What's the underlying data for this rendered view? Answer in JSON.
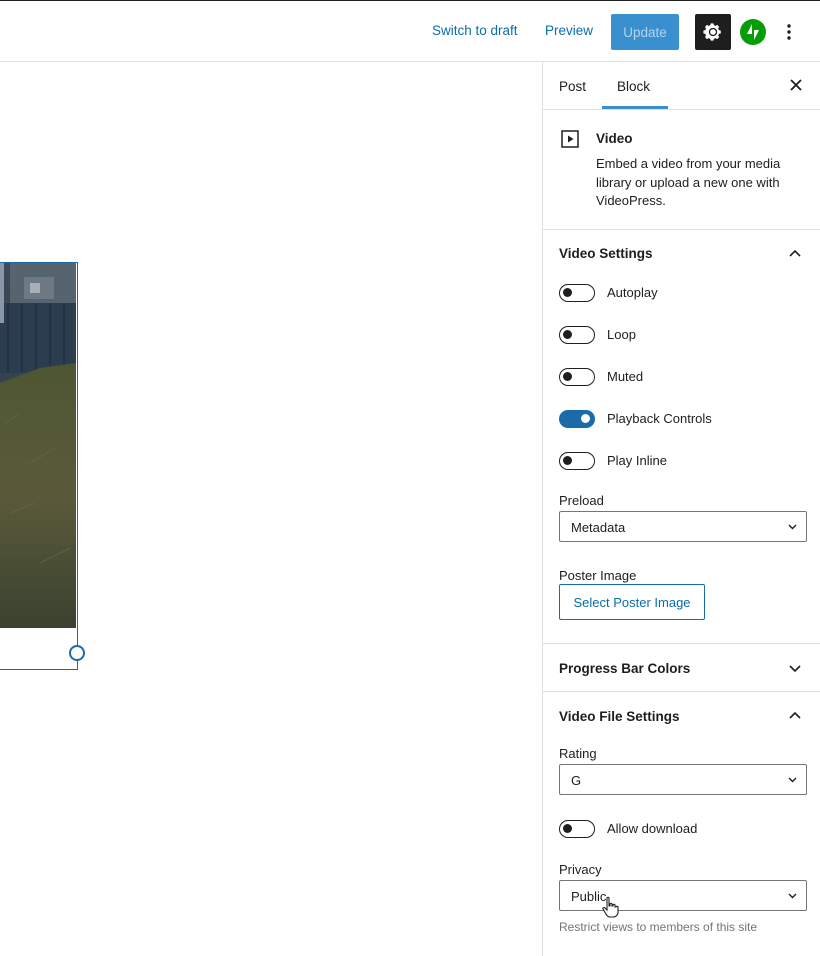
{
  "header": {
    "switch_to_draft": "Switch to draft",
    "preview": "Preview",
    "update": "Update",
    "settings_icon": "gear-icon",
    "jetpack_icon": "jetpack-icon",
    "more_icon": "vertical-ellipsis-icon"
  },
  "sidebar": {
    "tabs": [
      {
        "label": "Post"
      },
      {
        "label": "Block",
        "active": true
      }
    ],
    "close_icon": "close-icon",
    "block_card": {
      "icon": "video-icon",
      "title": "Video",
      "description": "Embed a video from your media library or upload a new one with VideoPress."
    },
    "video_settings": {
      "title": "Video Settings",
      "expanded": true,
      "toggles": [
        {
          "label": "Autoplay",
          "on": false
        },
        {
          "label": "Loop",
          "on": false
        },
        {
          "label": "Muted",
          "on": false
        },
        {
          "label": "Playback Controls",
          "on": true
        },
        {
          "label": "Play Inline",
          "on": false
        }
      ],
      "preload_label": "Preload",
      "preload_value": "Metadata",
      "poster_label": "Poster Image",
      "poster_button": "Select Poster Image"
    },
    "progress_bar": {
      "title": "Progress Bar Colors",
      "expanded": false
    },
    "video_file_settings": {
      "title": "Video File Settings",
      "expanded": true,
      "rating_label": "Rating",
      "rating_value": "G",
      "allow_download_label": "Allow download",
      "allow_download_on": false,
      "privacy_label": "Privacy",
      "privacy_value": "Public",
      "privacy_help": "Restrict views to members of this site"
    }
  },
  "colors": {
    "accent": "#1c6aa8",
    "link": "#0a6dab",
    "update_bg": "#3a8fce",
    "jetpack_green": "#069e08"
  }
}
